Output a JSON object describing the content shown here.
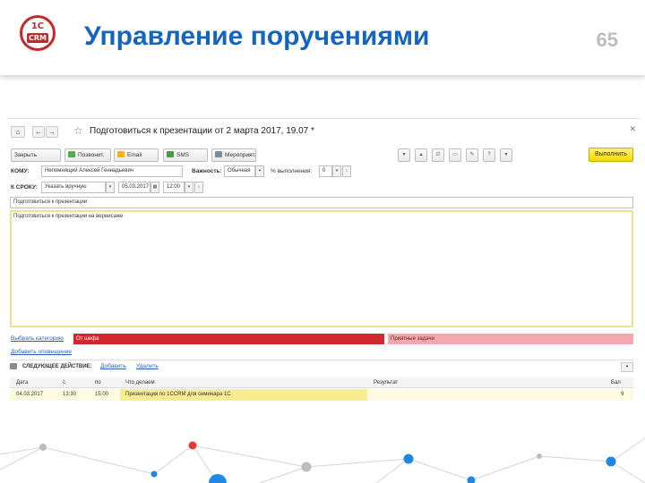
{
  "slide": {
    "logo_top": "1C",
    "logo_bottom": "CRM",
    "title": "Управление поручениями",
    "page_number": "65"
  },
  "window": {
    "doc_title": "Подготовиться к презентации от 2 марта 2017, 19.07 *",
    "toolbar": {
      "close_label": "Закрыть",
      "call_label": "Позвонит.",
      "email_label": "Email",
      "sms_label": "SMS",
      "event_label": "Мероприят.",
      "execute_label": "Выполнить"
    },
    "form": {
      "to_label": "КОМУ:",
      "to_value": "Непомнящий Алексей Геннадьевич",
      "importance_label": "Важность:",
      "importance_value": "Обычная",
      "percent_label": "% выполнения:",
      "percent_value": "0",
      "deadline_label": "К СРОКУ:",
      "deadline_mode": "Указать вручную",
      "deadline_date": "05.03.2017",
      "deadline_time": "12:00",
      "subject": "Подготовиться к презентации",
      "description": "Подготовиться к презентации на вернисаже"
    },
    "categories": {
      "choose_link": "Выбрать категорию",
      "cat1": "От шефа",
      "cat2": "Приятные задачи",
      "add_alert_link": "Добавить оповещение"
    },
    "next_action": {
      "label": "СЛЕДУЮЩЕЕ ДЕЙСТВИЕ:",
      "add_link": "Добавить",
      "delete_link": "Удалить"
    },
    "table": {
      "headers": [
        "Дата",
        "с",
        "по",
        "Что делаем",
        "Результат",
        "Бал"
      ],
      "rows": [
        [
          "04.03.2017",
          "13:30",
          "15:00",
          "Презентация по 1CCRM для семинара 1С",
          "",
          "9"
        ]
      ]
    }
  },
  "colors": {
    "title_blue": "#1565c0",
    "cat_red": "#d0282e",
    "cat_pink": "#f2a9ad",
    "execute_yellow": "#f5de14",
    "network_blue": "#1e88e5",
    "network_red": "#e53935"
  }
}
